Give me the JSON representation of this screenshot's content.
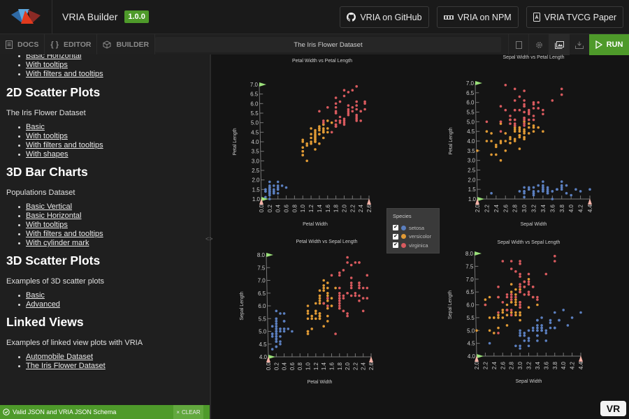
{
  "header": {
    "app_title": "VRIA Builder",
    "version": "1.0.0",
    "links": [
      {
        "label": "VRIA on GitHub",
        "icon": "github-icon"
      },
      {
        "label": "VRIA on NPM",
        "icon": "npm-icon"
      },
      {
        "label": "VRIA TVCG Paper",
        "icon": "pdf-icon"
      }
    ]
  },
  "toolbar": {
    "tabs": [
      {
        "label": "DOCS",
        "icon": "book-icon"
      },
      {
        "label": "EDITOR",
        "icon": "braces-icon"
      },
      {
        "label": "BUILDER",
        "icon": "cube-icon"
      }
    ],
    "document_title": "The Iris Flower Dataset",
    "icons": [
      "json-file-icon",
      "gear-icon",
      "gallery-icon",
      "download-icon"
    ],
    "run_label": "RUN"
  },
  "sidebar": {
    "top_items": [
      "Basic Horizontal",
      "With tooltips",
      "With filters and tooltips"
    ],
    "sections": [
      {
        "heading": "2D Scatter Plots",
        "desc": "The Iris Flower Dataset",
        "items": [
          "Basic",
          "With tooltips",
          "With filters and tooltips",
          "With shapes"
        ]
      },
      {
        "heading": "3D Bar Charts",
        "desc": "Populations Dataset",
        "items": [
          "Basic Vertical",
          "Basic Horizontal",
          "With tooltips",
          "With filters and tooltips",
          "With cylinder mark"
        ]
      },
      {
        "heading": "3D Scatter Plots",
        "desc": "Examples of 3D scatter plots",
        "items": [
          "Basic",
          "Advanced"
        ]
      },
      {
        "heading": "Linked Views",
        "desc": "Examples of linked view plots with VRIA",
        "items": [
          "Automobile Dataset",
          "The Iris Flower Dataset"
        ]
      }
    ]
  },
  "status": {
    "message": "Valid JSON and VRIA JSON Schema",
    "clear_label": "CLEAR"
  },
  "vr_label": "VR",
  "legend": {
    "title": "Species",
    "items": [
      {
        "label": "setosa",
        "color": "#5b7fbf",
        "checked": true
      },
      {
        "label": "versicolor",
        "color": "#e09a35",
        "checked": true
      },
      {
        "label": "virginica",
        "color": "#d85a5e",
        "checked": true
      }
    ]
  },
  "chart_data": [
    {
      "type": "scatter",
      "title": "Petal Width vs Petal Length",
      "xlabel": "Petal Width",
      "ylabel": "Petal Length",
      "x_field": "pw",
      "y_field": "pl",
      "xlim": [
        0.0,
        2.6
      ],
      "ylim": [
        1.0,
        7.0
      ],
      "xticks": [
        "0.0",
        "0.2",
        "0.4",
        "0.6",
        "0.8",
        "1.0",
        "1.2",
        "1.4",
        "1.6",
        "1.8",
        "2.0",
        "2.2",
        "2.4",
        "2.6"
      ],
      "yticks": [
        "1.0",
        "1.5",
        "2.0",
        "2.5",
        "3.0",
        "3.5",
        "4.0",
        "4.5",
        "5.0",
        "5.5",
        "6.0",
        "6.5",
        "7.0"
      ]
    },
    {
      "type": "scatter",
      "title": "Sepal Width vs Petal Length",
      "xlabel": "Sepal Width",
      "ylabel": "Petal Length",
      "x_field": "sw",
      "y_field": "pl",
      "xlim": [
        2.0,
        4.4
      ],
      "ylim": [
        1.0,
        7.0
      ],
      "xticks": [
        "2.0",
        "2.2",
        "2.4",
        "2.6",
        "2.8",
        "3.0",
        "3.2",
        "3.4",
        "3.6",
        "3.8",
        "4.0",
        "4.2",
        "4.4"
      ],
      "yticks": [
        "1.0",
        "1.5",
        "2.0",
        "2.5",
        "3.0",
        "3.5",
        "4.0",
        "4.5",
        "5.0",
        "5.5",
        "6.0",
        "6.5",
        "7.0"
      ]
    },
    {
      "type": "scatter",
      "title": "Petal Width vs Sepal Length",
      "xlabel": "Petal Width",
      "ylabel": "Sepal Length",
      "x_field": "pw",
      "y_field": "sl",
      "xlim": [
        0.0,
        2.6
      ],
      "ylim": [
        4.0,
        8.0
      ],
      "xticks": [
        "0.0",
        "0.2",
        "0.4",
        "0.6",
        "0.8",
        "1.0",
        "1.2",
        "1.4",
        "1.6",
        "1.8",
        "2.0",
        "2.2",
        "2.4",
        "2.6"
      ],
      "yticks": [
        "4.0",
        "4.5",
        "5.0",
        "5.5",
        "6.0",
        "6.5",
        "7.0",
        "7.5",
        "8.0"
      ]
    },
    {
      "type": "scatter",
      "title": "Sepal Width vs Sepal Length",
      "xlabel": "Sepal Width",
      "ylabel": "Sepal Length",
      "x_field": "sw",
      "y_field": "sl",
      "xlim": [
        2.0,
        4.4
      ],
      "ylim": [
        4.0,
        8.0
      ],
      "xticks": [
        "2.0",
        "2.2",
        "2.4",
        "2.6",
        "2.8",
        "3.0",
        "3.2",
        "3.4",
        "3.6",
        "3.8",
        "4.0",
        "4.2",
        "4.4"
      ],
      "yticks": [
        "4.0",
        "4.5",
        "5.0",
        "5.5",
        "6.0",
        "6.5",
        "7.0",
        "7.5",
        "8.0"
      ]
    }
  ],
  "iris": {
    "fields": [
      "sl",
      "sw",
      "pl",
      "pw",
      "species"
    ],
    "setosa": [
      [
        5.1,
        3.5,
        1.4,
        0.2
      ],
      [
        4.9,
        3.0,
        1.4,
        0.2
      ],
      [
        4.7,
        3.2,
        1.3,
        0.2
      ],
      [
        4.6,
        3.1,
        1.5,
        0.2
      ],
      [
        5.0,
        3.6,
        1.4,
        0.2
      ],
      [
        5.4,
        3.9,
        1.7,
        0.4
      ],
      [
        4.6,
        3.4,
        1.4,
        0.3
      ],
      [
        5.0,
        3.4,
        1.5,
        0.2
      ],
      [
        4.4,
        2.9,
        1.4,
        0.2
      ],
      [
        4.9,
        3.1,
        1.5,
        0.1
      ],
      [
        5.4,
        3.7,
        1.5,
        0.2
      ],
      [
        4.8,
        3.4,
        1.6,
        0.2
      ],
      [
        4.8,
        3.0,
        1.4,
        0.1
      ],
      [
        4.3,
        3.0,
        1.1,
        0.1
      ],
      [
        5.8,
        4.0,
        1.2,
        0.2
      ],
      [
        5.7,
        4.4,
        1.5,
        0.4
      ],
      [
        5.4,
        3.9,
        1.3,
        0.4
      ],
      [
        5.1,
        3.5,
        1.4,
        0.3
      ],
      [
        5.7,
        3.8,
        1.7,
        0.3
      ],
      [
        5.1,
        3.8,
        1.5,
        0.3
      ],
      [
        5.4,
        3.4,
        1.7,
        0.2
      ],
      [
        5.1,
        3.7,
        1.5,
        0.4
      ],
      [
        4.6,
        3.6,
        1.0,
        0.2
      ],
      [
        5.1,
        3.3,
        1.7,
        0.5
      ],
      [
        4.8,
        3.4,
        1.9,
        0.2
      ],
      [
        5.0,
        3.0,
        1.6,
        0.2
      ],
      [
        5.0,
        3.4,
        1.6,
        0.4
      ],
      [
        5.2,
        3.5,
        1.5,
        0.2
      ],
      [
        5.2,
        3.4,
        1.4,
        0.2
      ],
      [
        4.7,
        3.2,
        1.6,
        0.2
      ],
      [
        4.8,
        3.1,
        1.6,
        0.2
      ],
      [
        5.4,
        3.4,
        1.5,
        0.4
      ],
      [
        5.2,
        4.1,
        1.5,
        0.1
      ],
      [
        5.5,
        4.2,
        1.4,
        0.2
      ],
      [
        4.9,
        3.1,
        1.5,
        0.2
      ],
      [
        5.0,
        3.2,
        1.2,
        0.2
      ],
      [
        5.5,
        3.5,
        1.3,
        0.2
      ],
      [
        4.9,
        3.6,
        1.4,
        0.1
      ],
      [
        4.4,
        3.0,
        1.3,
        0.2
      ],
      [
        5.1,
        3.4,
        1.5,
        0.2
      ],
      [
        5.0,
        3.5,
        1.3,
        0.3
      ],
      [
        4.5,
        2.3,
        1.3,
        0.3
      ],
      [
        4.4,
        3.2,
        1.3,
        0.2
      ],
      [
        5.0,
        3.5,
        1.6,
        0.6
      ],
      [
        5.1,
        3.8,
        1.9,
        0.4
      ],
      [
        4.8,
        3.0,
        1.4,
        0.3
      ],
      [
        5.1,
        3.8,
        1.6,
        0.2
      ],
      [
        4.6,
        3.2,
        1.4,
        0.2
      ],
      [
        5.3,
        3.7,
        1.5,
        0.2
      ],
      [
        5.0,
        3.3,
        1.4,
        0.2
      ]
    ],
    "versicolor": [
      [
        7.0,
        3.2,
        4.7,
        1.4
      ],
      [
        6.4,
        3.2,
        4.5,
        1.5
      ],
      [
        6.9,
        3.1,
        4.9,
        1.5
      ],
      [
        5.5,
        2.3,
        4.0,
        1.3
      ],
      [
        6.5,
        2.8,
        4.6,
        1.5
      ],
      [
        5.7,
        2.8,
        4.5,
        1.3
      ],
      [
        6.3,
        3.3,
        4.7,
        1.6
      ],
      [
        4.9,
        2.4,
        3.3,
        1.0
      ],
      [
        6.6,
        2.9,
        4.6,
        1.3
      ],
      [
        5.2,
        2.7,
        3.9,
        1.4
      ],
      [
        5.0,
        2.0,
        3.5,
        1.0
      ],
      [
        5.9,
        3.0,
        4.2,
        1.5
      ],
      [
        6.0,
        2.2,
        4.0,
        1.0
      ],
      [
        6.1,
        2.9,
        4.7,
        1.4
      ],
      [
        5.6,
        2.9,
        3.6,
        1.3
      ],
      [
        6.7,
        3.1,
        4.4,
        1.4
      ],
      [
        5.6,
        3.0,
        4.5,
        1.5
      ],
      [
        5.8,
        2.7,
        4.1,
        1.0
      ],
      [
        6.2,
        2.2,
        4.5,
        1.5
      ],
      [
        5.6,
        2.5,
        3.9,
        1.1
      ],
      [
        5.9,
        3.2,
        4.8,
        1.8
      ],
      [
        6.1,
        2.8,
        4.0,
        1.3
      ],
      [
        6.3,
        2.5,
        4.9,
        1.5
      ],
      [
        6.1,
        2.8,
        4.7,
        1.2
      ],
      [
        6.4,
        2.9,
        4.3,
        1.3
      ],
      [
        6.6,
        3.0,
        4.4,
        1.4
      ],
      [
        6.8,
        2.8,
        4.8,
        1.4
      ],
      [
        6.7,
        3.0,
        5.0,
        1.7
      ],
      [
        6.0,
        2.9,
        4.5,
        1.5
      ],
      [
        5.7,
        2.6,
        3.5,
        1.0
      ],
      [
        5.5,
        2.4,
        3.8,
        1.1
      ],
      [
        5.5,
        2.4,
        3.7,
        1.0
      ],
      [
        5.8,
        2.7,
        3.9,
        1.2
      ],
      [
        6.0,
        2.7,
        5.1,
        1.6
      ],
      [
        5.4,
        3.0,
        4.5,
        1.5
      ],
      [
        6.0,
        3.4,
        4.5,
        1.6
      ],
      [
        6.7,
        3.1,
        4.7,
        1.5
      ],
      [
        6.3,
        2.3,
        4.4,
        1.3
      ],
      [
        5.6,
        3.0,
        4.1,
        1.3
      ],
      [
        5.5,
        2.5,
        4.0,
        1.3
      ],
      [
        5.5,
        2.6,
        4.4,
        1.2
      ],
      [
        6.1,
        3.0,
        4.6,
        1.4
      ],
      [
        5.8,
        2.6,
        4.0,
        1.2
      ],
      [
        5.0,
        2.3,
        3.3,
        1.0
      ],
      [
        5.6,
        2.7,
        4.2,
        1.3
      ],
      [
        5.7,
        3.0,
        4.2,
        1.2
      ],
      [
        5.7,
        2.9,
        4.2,
        1.3
      ],
      [
        6.2,
        2.9,
        4.3,
        1.3
      ],
      [
        5.1,
        2.5,
        3.0,
        1.1
      ],
      [
        5.7,
        2.8,
        4.1,
        1.3
      ]
    ],
    "virginica": [
      [
        6.3,
        3.3,
        6.0,
        2.5
      ],
      [
        5.8,
        2.7,
        5.1,
        1.9
      ],
      [
        7.1,
        3.0,
        5.9,
        2.1
      ],
      [
        6.3,
        2.9,
        5.6,
        1.8
      ],
      [
        6.5,
        3.0,
        5.8,
        2.2
      ],
      [
        7.6,
        3.0,
        6.6,
        2.1
      ],
      [
        4.9,
        2.5,
        4.5,
        1.7
      ],
      [
        7.3,
        2.9,
        6.3,
        1.8
      ],
      [
        6.7,
        2.5,
        5.8,
        1.8
      ],
      [
        7.2,
        3.6,
        6.1,
        2.5
      ],
      [
        6.5,
        3.2,
        5.1,
        2.0
      ],
      [
        6.4,
        2.7,
        5.3,
        1.9
      ],
      [
        6.8,
        3.0,
        5.5,
        2.1
      ],
      [
        5.7,
        2.5,
        5.0,
        2.0
      ],
      [
        5.8,
        2.8,
        5.1,
        2.4
      ],
      [
        6.4,
        3.2,
        5.3,
        2.3
      ],
      [
        6.5,
        3.0,
        5.5,
        1.8
      ],
      [
        7.7,
        3.8,
        6.7,
        2.2
      ],
      [
        7.7,
        2.6,
        6.9,
        2.3
      ],
      [
        6.0,
        2.2,
        5.0,
        1.5
      ],
      [
        6.9,
        3.2,
        5.7,
        2.3
      ],
      [
        5.6,
        2.8,
        4.9,
        2.0
      ],
      [
        7.7,
        2.8,
        6.7,
        2.0
      ],
      [
        6.3,
        2.7,
        4.9,
        1.8
      ],
      [
        6.7,
        3.3,
        5.7,
        2.1
      ],
      [
        7.2,
        3.2,
        6.0,
        1.8
      ],
      [
        6.2,
        2.8,
        4.8,
        1.8
      ],
      [
        6.1,
        3.0,
        4.9,
        1.8
      ],
      [
        6.4,
        2.8,
        5.6,
        2.1
      ],
      [
        7.2,
        3.0,
        5.8,
        1.6
      ],
      [
        7.4,
        2.8,
        6.1,
        1.9
      ],
      [
        7.9,
        3.8,
        6.4,
        2.0
      ],
      [
        6.4,
        2.8,
        5.6,
        2.2
      ],
      [
        6.3,
        2.8,
        5.1,
        1.5
      ],
      [
        6.1,
        2.6,
        5.6,
        1.4
      ],
      [
        7.7,
        3.0,
        6.1,
        2.3
      ],
      [
        6.3,
        3.4,
        5.6,
        2.4
      ],
      [
        6.4,
        3.1,
        5.5,
        1.8
      ],
      [
        6.0,
        3.0,
        4.8,
        1.8
      ],
      [
        6.9,
        3.1,
        5.4,
        2.1
      ],
      [
        6.7,
        3.1,
        5.6,
        2.4
      ],
      [
        6.9,
        3.1,
        5.1,
        2.3
      ],
      [
        5.8,
        2.7,
        5.1,
        1.9
      ],
      [
        6.8,
        3.2,
        5.9,
        2.3
      ],
      [
        6.7,
        3.3,
        5.7,
        2.5
      ],
      [
        6.7,
        3.0,
        5.2,
        2.3
      ],
      [
        6.3,
        2.5,
        5.0,
        1.9
      ],
      [
        6.5,
        3.0,
        5.2,
        2.0
      ],
      [
        6.2,
        3.4,
        5.4,
        2.3
      ],
      [
        5.9,
        3.0,
        5.1,
        1.8
      ]
    ]
  }
}
